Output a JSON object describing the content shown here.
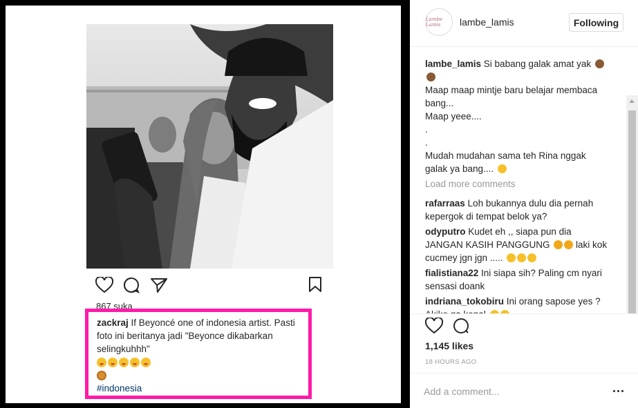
{
  "post_image": {
    "likes_text": "867 suka",
    "caption": {
      "username": "zackraj",
      "text": " If Beyoncé one of indonesia artist. Pasti foto ini beritanya jadi \"Beyonce dikabarkan selingkuhhh\"",
      "hashtag": "#indonesia"
    },
    "highlight_color": "#ff1aa8"
  },
  "header": {
    "avatar_text": "Lambe Lamis",
    "username": "lambe_lamis",
    "follow_label": "Following"
  },
  "comments": {
    "main": {
      "username": "lambe_lamis",
      "lines": [
        " Si babang galak amat yak",
        "Maap maap mintje baru belajar membaca bang...",
        "Maap yeee....",
        ".",
        ".",
        "Mudah mudahan sama teh Rina nggak galak ya bang...."
      ]
    },
    "load_more": "Load more comments",
    "items": [
      {
        "username": "rafarraas",
        "text": " Loh bukannya dulu dia pernah kepergok di tempat belok ya?"
      },
      {
        "username": "odyputro",
        "text": " Kudet eh ,, siapa pun dia JANGAN KASIH PANGGUNG",
        "text2": " laki kok cucmey jgn jgn ....."
      },
      {
        "username": "fialistiana22",
        "text": " Ini siapa sih? Paling cm nyari sensasi doank"
      },
      {
        "username": "indriana_tokobiru",
        "text": " Ini orang sapose yes ? Akiko ga kenal"
      }
    ]
  },
  "actions": {
    "likes": "1,145 likes",
    "timestamp": "18 HOURS AGO"
  },
  "comment_bar": {
    "placeholder": "Add a comment..."
  },
  "icons": {
    "like": "heart-icon",
    "comment": "comment-bubble-icon",
    "share": "paper-plane-icon",
    "bookmark": "bookmark-icon",
    "more": "ellipsis-icon"
  }
}
